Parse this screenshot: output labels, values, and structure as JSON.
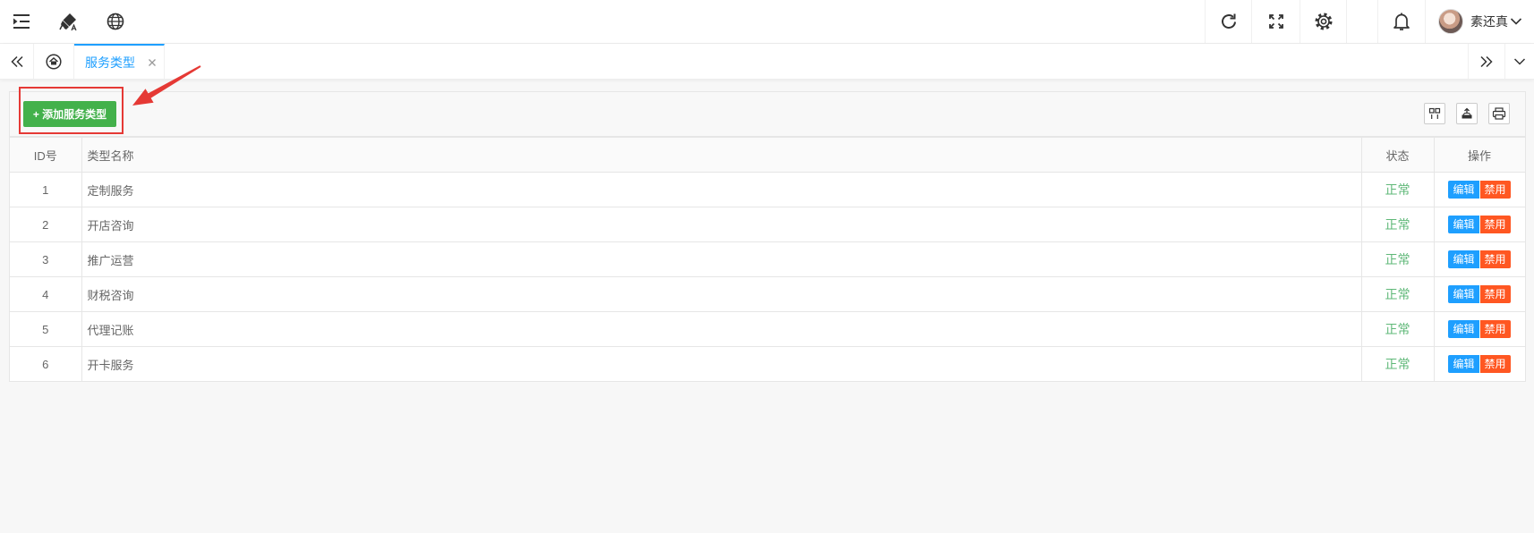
{
  "header": {
    "left_icons": [
      "menu-fold-icon",
      "theme-brush-icon",
      "language-globe-icon"
    ],
    "right_icons": [
      "refresh-icon",
      "fullscreen-icon",
      "settings-gear-icon",
      "notification-bell-icon"
    ],
    "user": {
      "name": "素还真"
    }
  },
  "tabbar": {
    "tabs": [
      {
        "label": "服务类型",
        "active": true
      }
    ]
  },
  "toolbar": {
    "add_button_label": "+ 添加服务类型",
    "right_icons": [
      "columns-filter-icon",
      "export-icon",
      "print-icon"
    ]
  },
  "table": {
    "columns": [
      "ID号",
      "类型名称",
      "状态",
      "操作"
    ],
    "rows": [
      {
        "id": "1",
        "name": "定制服务",
        "status": "正常"
      },
      {
        "id": "2",
        "name": "开店咨询",
        "status": "正常"
      },
      {
        "id": "3",
        "name": "推广运营",
        "status": "正常"
      },
      {
        "id": "4",
        "name": "财税咨询",
        "status": "正常"
      },
      {
        "id": "5",
        "name": "代理记账",
        "status": "正常"
      },
      {
        "id": "6",
        "name": "开卡服务",
        "status": "正常"
      }
    ],
    "actions": {
      "edit_label": "编辑",
      "disable_label": "禁用"
    }
  },
  "colors": {
    "accent": "#1e9fff",
    "add_button": "#43b14b",
    "status_ok": "#5fb878",
    "danger": "#ff5722",
    "annotation": "#e53935"
  }
}
